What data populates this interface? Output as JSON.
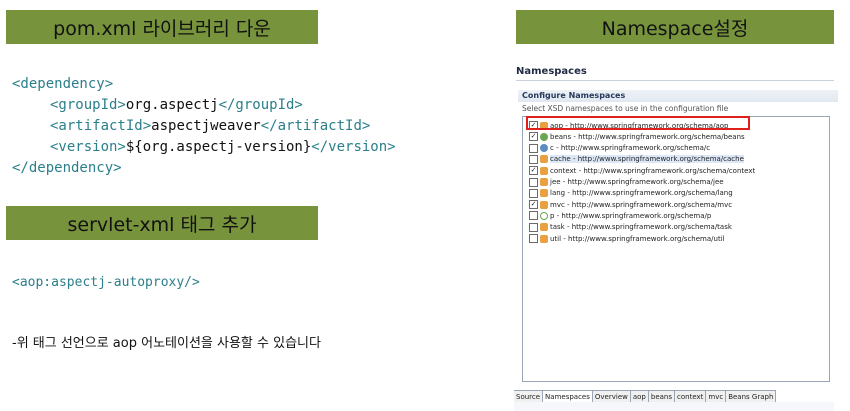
{
  "banners": {
    "pom": "pom.xml 라이브러리 다운",
    "servlet": "servlet-xml 태그 추가",
    "namespace": "Namespace설정"
  },
  "code": {
    "line1": "<dependency>",
    "line2_open": "<groupId>",
    "line2_val": "org.aspectj",
    "line2_close": "</groupId>",
    "line3_open": "<artifactId>",
    "line3_val": "aspectjweaver",
    "line3_close": "</artifactId>",
    "line4_open": "<version>",
    "line4_val": "${org.aspectj-version}",
    "line4_close": "</version>",
    "line5": "</dependency>"
  },
  "servlet_code": "<aop:aspectj-autoproxy/>",
  "note": "-위 태그 선언으로 aop 어노테이션을 사용할 수 있습니다",
  "panel": {
    "title": "Namespaces",
    "section_header": "Configure Namespaces",
    "description": "Select XSD namespaces to use in the configuration file",
    "namespaces": [
      {
        "label": "aop - http://www.springframework.org/schema/aop",
        "checked": true,
        "icon": "xsd-icon"
      },
      {
        "label": "beans - http://www.springframework.org/schema/beans",
        "checked": true,
        "icon": "bean-icon"
      },
      {
        "label": "c - http://www.springframework.org/schema/c",
        "checked": false,
        "icon": "c-icon"
      },
      {
        "label": "cache - http://www.springframework.org/schema/cache",
        "checked": false,
        "icon": "xsd-icon"
      },
      {
        "label": "context - http://www.springframework.org/schema/context",
        "checked": true,
        "icon": "xsd-icon"
      },
      {
        "label": "jee - http://www.springframework.org/schema/jee",
        "checked": false,
        "icon": "xsd-icon"
      },
      {
        "label": "lang - http://www.springframework.org/schema/lang",
        "checked": false,
        "icon": "xsd-icon"
      },
      {
        "label": "mvc - http://www.springframework.org/schema/mvc",
        "checked": true,
        "icon": "xsd-icon"
      },
      {
        "label": "p - http://www.springframework.org/schema/p",
        "checked": false,
        "icon": "p-icon"
      },
      {
        "label": "task - http://www.springframework.org/schema/task",
        "checked": false,
        "icon": "xsd-icon"
      },
      {
        "label": "util - http://www.springframework.org/schema/util",
        "checked": false,
        "icon": "xsd-icon"
      }
    ],
    "tabs": [
      "Source",
      "Namespaces",
      "Overview",
      "aop",
      "beans",
      "context",
      "mvc",
      "Beans Graph"
    ],
    "active_tab": "Namespaces"
  }
}
